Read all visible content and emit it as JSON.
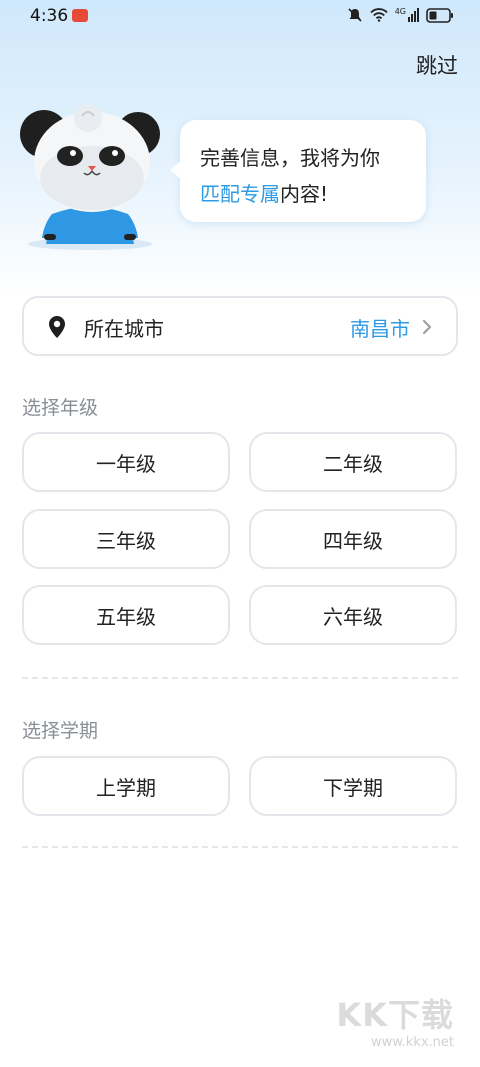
{
  "status_bar": {
    "time": "4:36",
    "icons": [
      "notification-app-icon",
      "mute-icon",
      "wifi-icon",
      "signal-4g-icon",
      "battery-icon"
    ],
    "network_label": "4G"
  },
  "header": {
    "skip_label": "跳过"
  },
  "bubble": {
    "line1": "完善信息，我将为你",
    "line2_highlight": "匹配专属",
    "line2_rest": "内容!"
  },
  "city": {
    "label": "所在城市",
    "value": "南昌市",
    "icon": "location-pin-icon"
  },
  "grade_section": {
    "title": "选择年级",
    "options": [
      "一年级",
      "二年级",
      "三年级",
      "四年级",
      "五年级",
      "六年级"
    ]
  },
  "term_section": {
    "title": "选择学期",
    "options": [
      "上学期",
      "下学期"
    ]
  },
  "watermark": {
    "logo_text": "KK下载",
    "url": "www.kkx.net"
  },
  "colors": {
    "accent": "#2e9be6",
    "border": "#e3e6ea",
    "muted_text": "#8a8f96",
    "header_gradient_top": "#cfe8fb"
  }
}
